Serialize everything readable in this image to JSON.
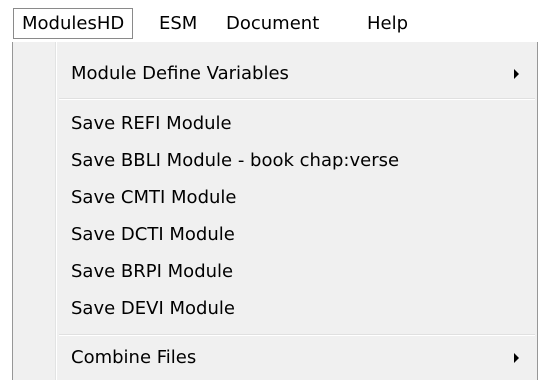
{
  "menubar": {
    "items": [
      {
        "label": "ModulesHD"
      },
      {
        "label": "ESM"
      },
      {
        "label": "Document"
      },
      {
        "label": "Help"
      }
    ]
  },
  "dropdown": {
    "items": [
      {
        "label": "Module Define Variables",
        "submenu": true
      },
      {
        "label": "Save REFI Module"
      },
      {
        "label": "Save BBLI Module - book chap:verse"
      },
      {
        "label": "Save CMTI Module"
      },
      {
        "label": "Save DCTI Module"
      },
      {
        "label": "Save BRPI Module"
      },
      {
        "label": "Save DEVI Module"
      },
      {
        "label": "Combine Files",
        "submenu": true
      }
    ]
  },
  "icons": {
    "submenu_arrow": "chevron-right-icon"
  }
}
